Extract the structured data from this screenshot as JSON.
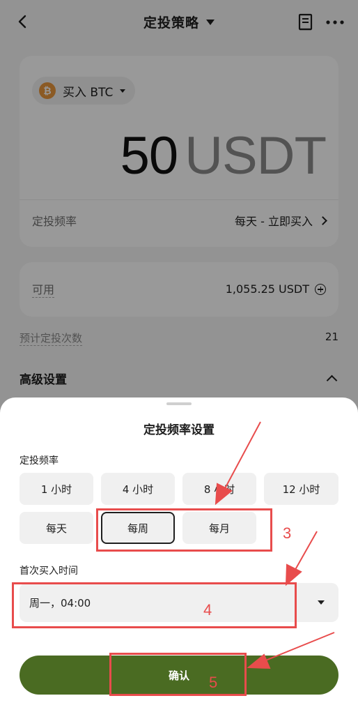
{
  "header": {
    "title": "定投策略"
  },
  "main": {
    "coin": {
      "logo_glyph": "₿",
      "label": "买入 BTC"
    },
    "amount": {
      "value": "50",
      "unit": "USDT"
    },
    "frequency": {
      "label": "定投频率",
      "value": "每天 - 立即买入"
    },
    "available": {
      "label": "可用",
      "value": "1,055.25 USDT"
    },
    "estimate": {
      "label": "预计定投次数",
      "value": "21"
    },
    "advanced": {
      "label": "高级设置"
    }
  },
  "sheet": {
    "title": "定投频率设置",
    "frequency_label": "定投频率",
    "options_row1": [
      "1 小时",
      "4 小时",
      "8 小时",
      "12 小时"
    ],
    "options_row2": [
      "每天",
      "每周",
      "每月"
    ],
    "selected_option": "每周",
    "first_buy_label": "首次买入时间",
    "first_buy_value": "周一，04:00",
    "confirm_label": "确认"
  },
  "annotations": {
    "color": "#e84c4c",
    "markers": [
      "3",
      "4",
      "5"
    ]
  },
  "icons": [
    "back-icon",
    "caret-down-icon",
    "document-icon",
    "more-icon",
    "bitcoin-icon",
    "chevron-right-icon",
    "plus-circle-icon",
    "chevron-up-icon",
    "triangle-down-icon"
  ]
}
